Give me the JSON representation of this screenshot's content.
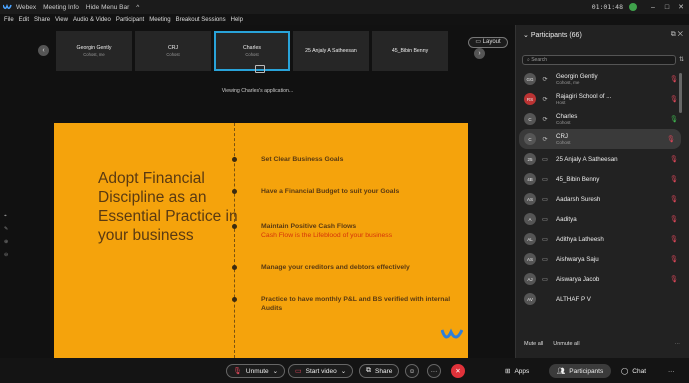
{
  "titlebar": {
    "app_name": "Webex",
    "meeting_info": "Meeting Info",
    "hide_menu": "Hide Menu Bar",
    "timer": "01:01:48",
    "minimize": "–",
    "maximize": "□",
    "close": "✕"
  },
  "menu": {
    "items": [
      "File",
      "Edit",
      "Share",
      "View",
      "Audio & Video",
      "Participant",
      "Meeting",
      "Breakout Sessions",
      "Help"
    ]
  },
  "filmstrip": {
    "tiles": [
      {
        "name": "Georgin Gently",
        "role": "Cohost, me"
      },
      {
        "name": "CRJ",
        "role": "Cohost"
      },
      {
        "name": "Charles",
        "role": "Cohost"
      },
      {
        "name": "25 Anjaly A Satheesan",
        "role": ""
      },
      {
        "name": "45_Bibin Benny",
        "role": ""
      }
    ],
    "layout_label": "Layout",
    "viewing_text": "Viewing Charles's application..."
  },
  "slide": {
    "heading": "Adopt Financial Discipline as an Essential Practice in your business",
    "points": [
      {
        "text": "Set Clear Business Goals",
        "sub": ""
      },
      {
        "text": "Have a Financial Budget to suit your Goals",
        "sub": ""
      },
      {
        "text": "Maintain Positive Cash Flows",
        "sub": "Cash Flow is the Lifeblood of your business"
      },
      {
        "text": "Manage your creditors and debtors effectively",
        "sub": ""
      },
      {
        "text": "Practice to have monthly P&L and BS verified with internal Audits",
        "sub": ""
      }
    ]
  },
  "controls": {
    "unmute": "Unmute",
    "start_video": "Start video",
    "share": "Share",
    "apps": "Apps",
    "participants": "Participants",
    "chat": "Chat",
    "more": "···"
  },
  "participants_panel": {
    "title": "Participants (66)",
    "search_placeholder": "Search",
    "mute_all": "Mute all",
    "unmute_all": "Unmute all",
    "more": "···",
    "list": [
      {
        "initials": "GG",
        "name": "Georgin Gently",
        "role": "Cohost, me",
        "device": "⟳",
        "mic": "muted-red"
      },
      {
        "initials": "RS",
        "name": "Rajagiri School of ...",
        "role": "Host",
        "device": "⟳",
        "mic": "muted-red"
      },
      {
        "initials": "C",
        "name": "Charles",
        "role": "Cohost",
        "device": "⟳",
        "mic": "active-green"
      },
      {
        "initials": "C",
        "name": "CRJ",
        "role": "Cohost",
        "device": "⟳",
        "mic": "muted-red"
      },
      {
        "initials": "25",
        "name": "25 Anjaly A Satheesan",
        "role": "",
        "device": "▭",
        "mic": "muted-red"
      },
      {
        "initials": "4B",
        "name": "45_Bibin Benny",
        "role": "",
        "device": "▭",
        "mic": "muted-red"
      },
      {
        "initials": "AS",
        "name": "Aadarsh Suresh",
        "role": "",
        "device": "▭",
        "mic": "muted-red"
      },
      {
        "initials": "A",
        "name": "Aaditya",
        "role": "",
        "device": "▭",
        "mic": "muted-red"
      },
      {
        "initials": "AL",
        "name": "Adithya Latheesh",
        "role": "",
        "device": "▭",
        "mic": "muted-red"
      },
      {
        "initials": "AS",
        "name": "Aishwarya Saju",
        "role": "",
        "device": "▭",
        "mic": "muted-red"
      },
      {
        "initials": "AJ",
        "name": "Aiswarya Jacob",
        "role": "",
        "device": "▭",
        "mic": "muted-red"
      },
      {
        "initials": "AV",
        "name": "ALTHAF P V",
        "role": "",
        "device": "",
        "mic": ""
      }
    ]
  },
  "colors": {
    "slide_bg": "#f5a30c",
    "accent_blue": "#29a3d9",
    "end_red": "#e0323a",
    "muted_red": "#e0475a",
    "active_green": "#3fb950"
  }
}
